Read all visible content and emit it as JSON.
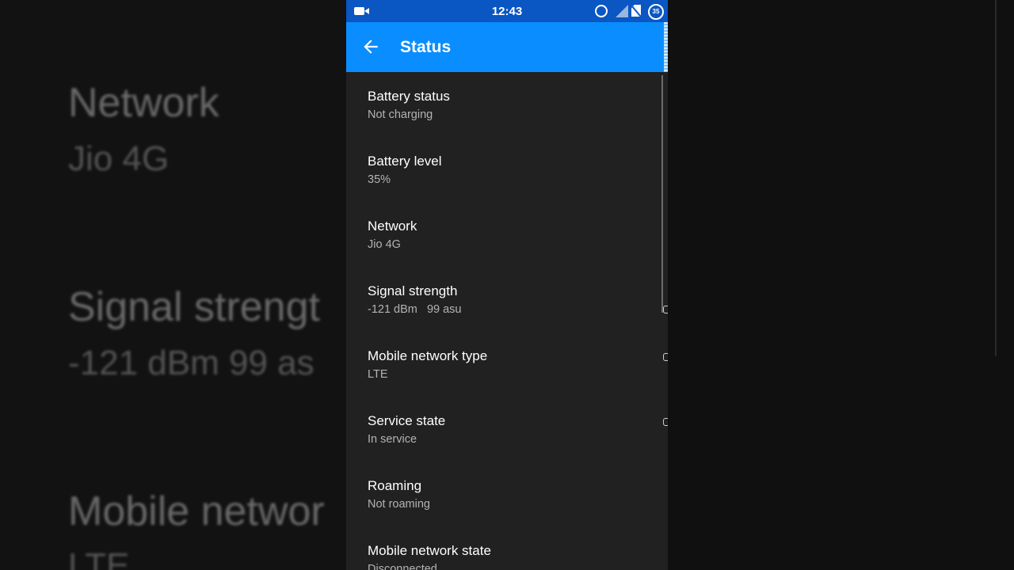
{
  "status_bar": {
    "time": "12:43",
    "battery_percent": "35"
  },
  "app_bar": {
    "title": "Status"
  },
  "items": [
    {
      "label": "Battery status",
      "value": "Not charging"
    },
    {
      "label": "Battery level",
      "value": "35%"
    },
    {
      "label": "Network",
      "value": "Jio 4G"
    },
    {
      "label": "Signal strength",
      "value": "-121 dBm   99 asu"
    },
    {
      "label": "Mobile network type",
      "value": "LTE"
    },
    {
      "label": "Service state",
      "value": "In service"
    },
    {
      "label": "Roaming",
      "value": "Not roaming"
    },
    {
      "label": "Mobile network state",
      "value": "Disconnected"
    }
  ],
  "background_zoom": {
    "lines": [
      {
        "title": "Network",
        "sub": "Jio 4G"
      },
      {
        "title": "Signal strengt",
        "sub": "-121 dBm   99 as"
      },
      {
        "title": "Mobile networ",
        "sub": "LTE"
      }
    ]
  },
  "colors": {
    "status_bar": "#0a56c2",
    "app_bar": "#0a8dff",
    "list_background": "#212121"
  },
  "icons": [
    "video-camera-icon",
    "alarm-icon",
    "signal-icon",
    "no-sim-icon",
    "battery-icon",
    "back-arrow-icon"
  ]
}
